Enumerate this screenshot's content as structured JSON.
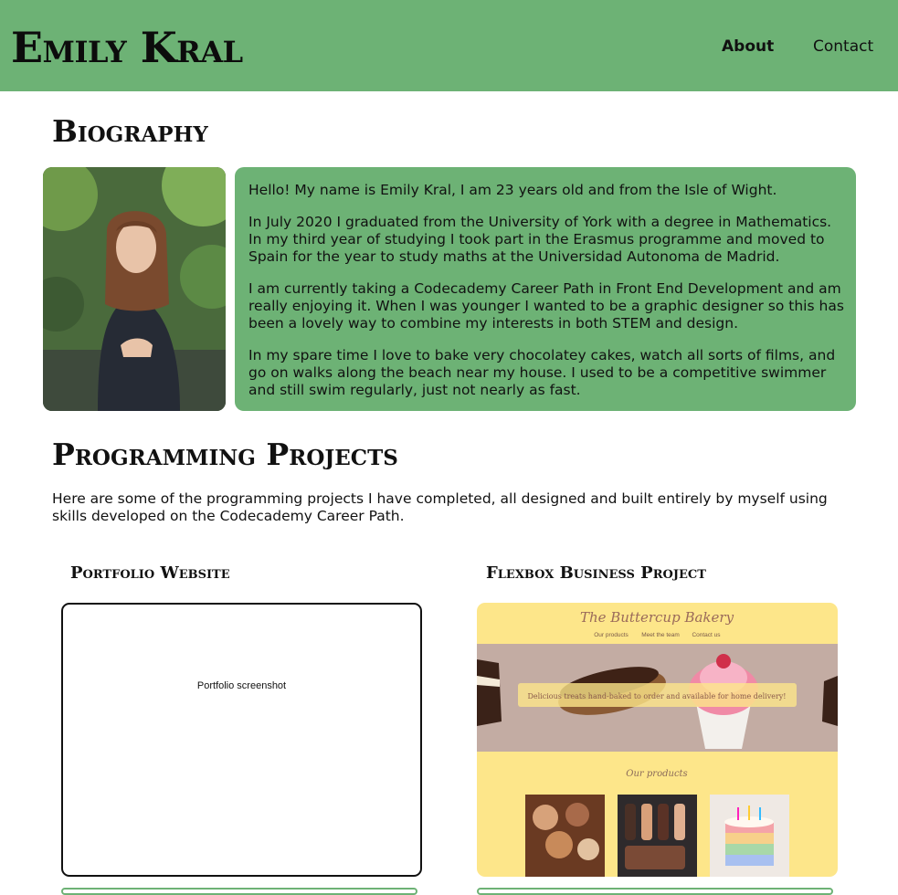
{
  "header": {
    "logo": "Emily Kral",
    "nav": {
      "about": "About",
      "contact": "Contact"
    }
  },
  "biography": {
    "title": "Biography",
    "paragraphs": [
      "Hello! My name is Emily Kral, I am 23 years old and from the Isle of Wight.",
      "In July 2020 I graduated from the University of York with a degree in Mathematics. In my third year of studying I took part in the Erasmus programme and moved to Spain for the year to study maths at the Universidad Autonoma de Madrid.",
      "I am currently taking a Codecademy Career Path in Front End Development and am really enjoying it. When I was younger I wanted to be a graphic designer so this has been a lovely way to combine my interests in both STEM and design.",
      "In my spare time I love to bake very chocolatey cakes, watch all sorts of films, and go on walks along the beach near my house. I used to be a competitive swimmer and still swim regularly, just not nearly as fast."
    ]
  },
  "projects": {
    "title": "Programming Projects",
    "intro": "Here are some of the programming projects I have completed, all designed and built entirely by myself using skills developed on the Codecademy Career Path.",
    "items": [
      {
        "title": "Portfolio Website",
        "screenshot_text": "Portfolio screenshot"
      },
      {
        "title": "Flexbox Business Project",
        "screenshot": {
          "site_title": "The Buttercup Bakery",
          "nav": [
            "Our products",
            "Meet the team",
            "Contact us"
          ],
          "banner": "Delicious treats hand-baked to order and available for home delivery!",
          "section": "Our products"
        }
      }
    ]
  },
  "colors": {
    "accent": "#6db275",
    "bakery_yellow": "#fde68a",
    "bakery_hero": "#c3aca3"
  }
}
